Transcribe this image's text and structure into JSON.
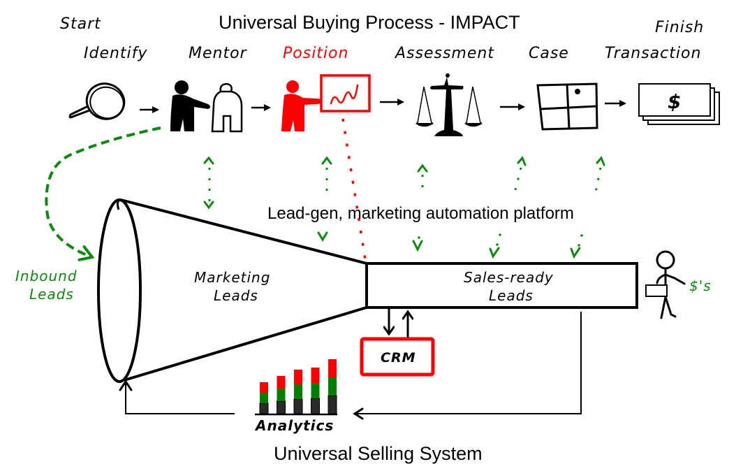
{
  "colors": {
    "ink": "#000000",
    "accent_red": "#ff0000",
    "accent_green": "#0a8a0a",
    "bar_dark": "#2a2a2a",
    "bar_green": "#008000",
    "bar_red": "#ff0000"
  },
  "header": {
    "title": "Universal Buying Process - IMPACT",
    "start_label": "Start",
    "finish_label": "Finish"
  },
  "stages": [
    {
      "label": "Identify",
      "icon": "magnifying-glass-icon",
      "highlight": false
    },
    {
      "label": "Mentor",
      "icon": "mentor-people-icon",
      "highlight": false
    },
    {
      "label": "Position",
      "icon": "presenter-chart-icon",
      "highlight": true
    },
    {
      "label": "Assessment",
      "icon": "balance-scale-icon",
      "highlight": false
    },
    {
      "label": "Case",
      "icon": "grid-quadrant-icon",
      "highlight": false
    },
    {
      "label": "Transaction",
      "icon": "money-stack-icon",
      "highlight": false
    }
  ],
  "money_symbol": "$",
  "platform_label": "Lead-gen, marketing automation platform",
  "funnel": {
    "inbound_label_line1": "Inbound",
    "inbound_label_line2": "Leads",
    "marketing_label_line1": "Marketing",
    "marketing_label_line2": "Leads",
    "sales_label_line1": "Sales-ready",
    "sales_label_line2": "Leads"
  },
  "crm_label": "CRM",
  "revenue_label": "$'s",
  "analytics": {
    "label": "Analytics",
    "bars": [
      {
        "dark": 0.3,
        "green": 0.3,
        "red": 0.3
      },
      {
        "dark": 0.36,
        "green": 0.36,
        "red": 0.36
      },
      {
        "dark": 0.42,
        "green": 0.42,
        "red": 0.42
      },
      {
        "dark": 0.44,
        "green": 0.44,
        "red": 0.44
      },
      {
        "dark": 0.52,
        "green": 0.52,
        "red": 0.52
      }
    ]
  },
  "footer": {
    "title": "Universal Selling System"
  }
}
